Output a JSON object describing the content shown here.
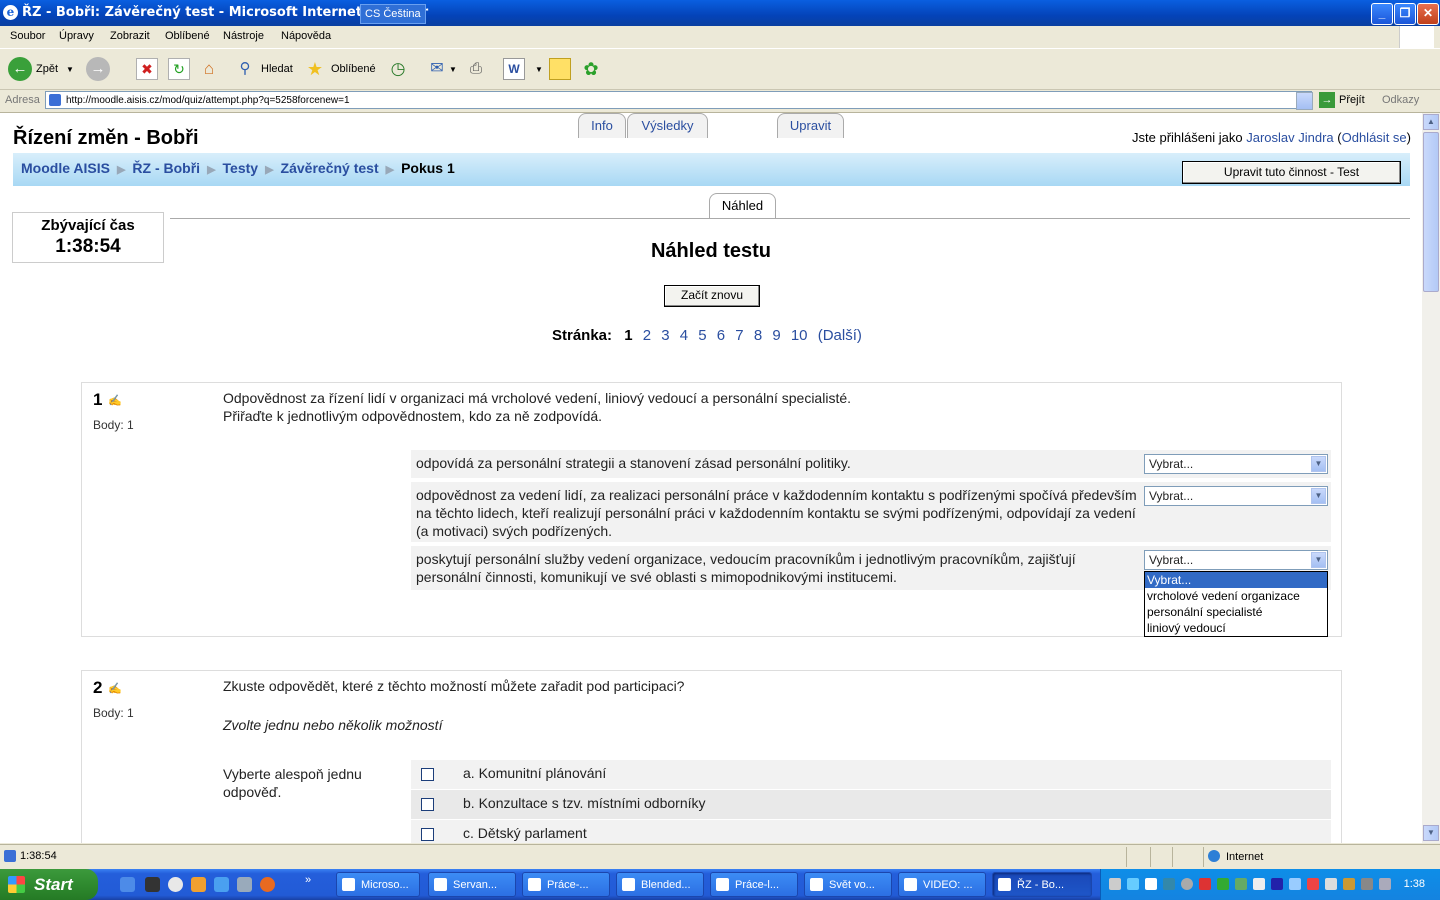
{
  "window": {
    "title": "ŘZ - Bobři: Závěrečný test - Microsoft Internet Explorer",
    "lang": "CS Čeština"
  },
  "menu": [
    "Soubor",
    "Úpravy",
    "Zobrazit",
    "Oblíbené",
    "Nástroje",
    "Nápověda"
  ],
  "toolbar": {
    "back": "Zpět",
    "search": "Hledat",
    "favorites": "Oblíbené"
  },
  "address": {
    "label": "Adresa",
    "url": "http://moodle.aisis.cz/mod/quiz/attempt.php?q=5258forcenew=1",
    "go": "Přejít",
    "links": "Odkazy"
  },
  "site": {
    "title": "Řízení změn - Bobři",
    "login_prefix": "Jste přihlášeni jako",
    "user": "Jaroslav Jindra",
    "logout": "Odhlásit se"
  },
  "breadcrumb": [
    "Moodle AISIS",
    "ŘZ - Bobři",
    "Testy",
    "Závěrečný test",
    "Pokus 1"
  ],
  "edit_button": "Upravit tuto činnost - Test",
  "tabs": [
    "Info",
    "Výsledky",
    "Náhled",
    "Upravit"
  ],
  "timer": {
    "label": "Zbývající čas",
    "value": "1:38:54"
  },
  "heading": "Náhled testu",
  "restart_button": "Začít znovu",
  "paging": {
    "label": "Stránka:",
    "current": "1",
    "pages": [
      "2",
      "3",
      "4",
      "5",
      "6",
      "7",
      "8",
      "9",
      "10"
    ],
    "next": "(Další)"
  },
  "q1": {
    "number": "1",
    "grade": "Body: 1",
    "text1": "Odpovědnost za řízení lidí v organizaci má vrcholové vedení, liniový vedoucí a personální specialisté.",
    "text2": "Přiřaďte k jednotlivým odpovědnostem, kdo za ně zodpovídá.",
    "rows": [
      "odpovídá za personální strategii a stanovení zásad personální politiky.",
      "odpovědnost za vedení lidí, za realizaci personální práce v každodenním kontaktu s podřízenými spočívá především na těchto lidech, kteří realizují personální práci v každodenním kontaktu se svými podřízenými, odpovídají za vedení (a motivaci) svých podřízených.",
      "poskytují personální služby vedení organizace, vedoucím pracovníkům i jednotlivým pracovníkům, zajišťují personální činnosti, komunikují ve své oblasti s mimopodnikovými institucemi."
    ],
    "select_value": "Vybrat...",
    "dropdown_options": [
      "Vybrat...",
      "vrcholové vedení organizace",
      "personální specialisté",
      "liniový vedoucí"
    ]
  },
  "q2": {
    "number": "2",
    "grade": "Body: 1",
    "text": "Zkuste odpovědět, které z těchto možností můžete zařadit pod participaci?",
    "hint": "Zvolte jednu nebo několik možností",
    "prompt": "Vyberte alespoň jednu odpověď.",
    "options": [
      "a. Komunitní plánování",
      "b. Konzultace s tzv. místními odborníky",
      "c. Dětský parlament"
    ]
  },
  "status": {
    "text": "1:38:54",
    "zone": "Internet"
  },
  "taskbar": {
    "start": "Start",
    "tasks": [
      "Microso...",
      "Servan...",
      "Práce-...",
      "Blended...",
      "Práce-l...",
      "Svět vo...",
      "VIDEO: ...",
      "ŘZ - Bo..."
    ],
    "clock": "1:38"
  }
}
